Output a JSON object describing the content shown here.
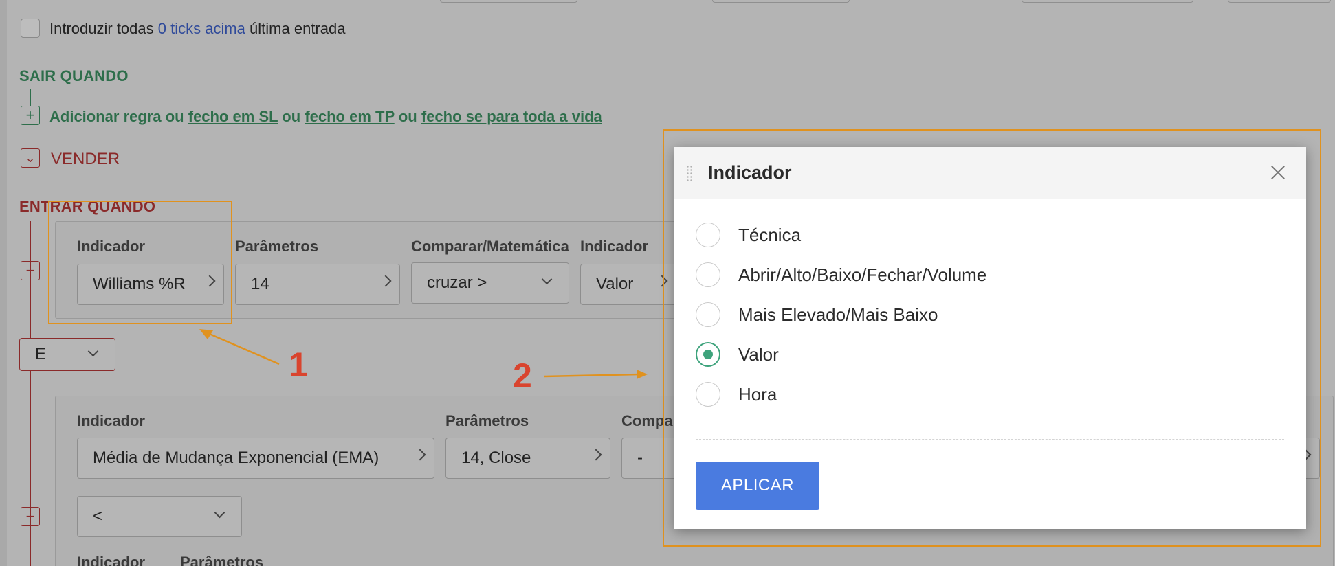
{
  "top": {
    "checkbox_label_prefix": "Introduzir todas",
    "checkbox_link": "0 ticks acima",
    "checkbox_label_suffix": "última entrada"
  },
  "exit_section": {
    "title": "SAIR QUANDO",
    "add_rule": "Adicionar regra",
    "or1": "ou",
    "close_sl": "fecho em SL",
    "or2": "ou",
    "close_tp": "fecho em TP",
    "or3": "ou",
    "close_lifetime": "fecho se para toda a vida"
  },
  "sell": {
    "label": "VENDER"
  },
  "enter_section": {
    "title": "ENTRAR QUANDO",
    "rule1": {
      "indicator_label": "Indicador",
      "indicator_value": "Williams %R",
      "params_label": "Parâmetros",
      "params_value": "14",
      "compare_label": "Comparar/Matemática",
      "compare_value": "cruzar >",
      "indicator2_label": "Indicador",
      "indicator2_value": "Valor"
    },
    "logic_value": "E",
    "rule2": {
      "indicator_label": "Indicador",
      "indicator_value": "Média de Mudança Exponencial (EMA)",
      "params_label": "Parâmetros",
      "params_value": "14, Close",
      "compare_label": "Compa",
      "compare_value": "-",
      "operator_value": "<"
    },
    "rule3": {
      "indicator_label": "Indicador",
      "params_label": "Parâmetros"
    }
  },
  "annotations": {
    "one": "1",
    "two": "2"
  },
  "modal": {
    "title": "Indicador",
    "options": [
      {
        "label": "Técnica",
        "selected": false
      },
      {
        "label": "Abrir/Alto/Baixo/Fechar/Volume",
        "selected": false
      },
      {
        "label": "Mais Elevado/Mais Baixo",
        "selected": false
      },
      {
        "label": "Valor",
        "selected": true
      },
      {
        "label": "Hora",
        "selected": false
      }
    ],
    "apply_label": "APLICAR"
  },
  "colors": {
    "accent_blue": "#4a7be0",
    "radio_green": "#3ea37c",
    "annotation_orange": "#e0921f",
    "annotation_red": "#d9442e"
  }
}
